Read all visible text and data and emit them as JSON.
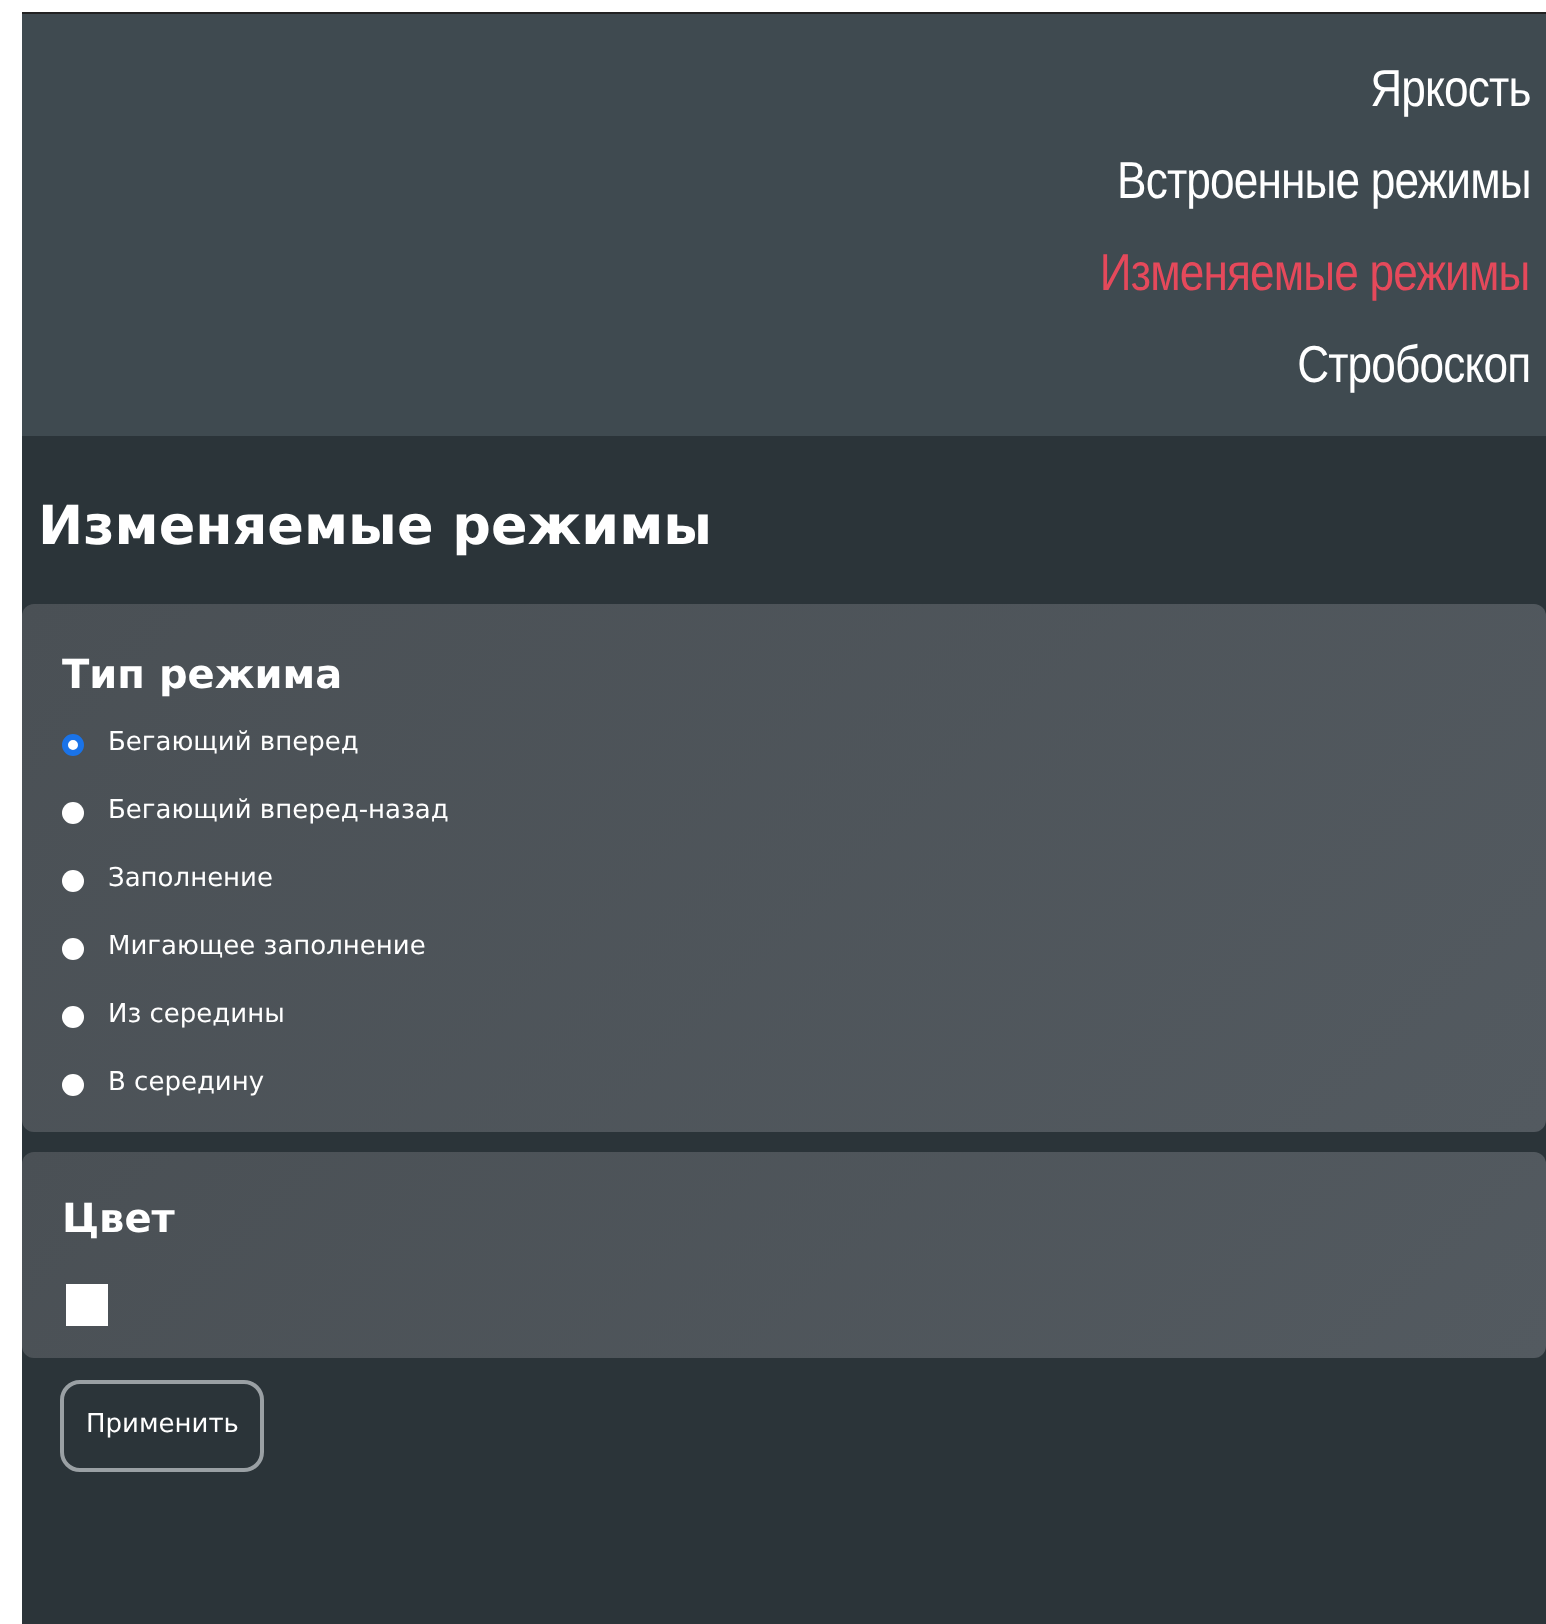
{
  "nav": [
    {
      "label": "Яркость",
      "selected": false
    },
    {
      "label": "Встроенные режимы",
      "selected": false
    },
    {
      "label": "Изменяемые режимы",
      "selected": true
    },
    {
      "label": "Стробоскоп",
      "selected": false
    }
  ],
  "page_title": "Изменяемые режимы",
  "mode_type": {
    "title": "Тип режима",
    "options": [
      {
        "label": "Бегающий вперед",
        "selected": true
      },
      {
        "label": "Бегающий вперед-назад",
        "selected": false
      },
      {
        "label": "Заполнение",
        "selected": false
      },
      {
        "label": "Мигающее заполнение",
        "selected": false
      },
      {
        "label": "Из середины",
        "selected": false
      },
      {
        "label": "В середину",
        "selected": false
      }
    ]
  },
  "color_section": {
    "title": "Цвет",
    "color": "#ffffff"
  },
  "apply_button": "Применить"
}
